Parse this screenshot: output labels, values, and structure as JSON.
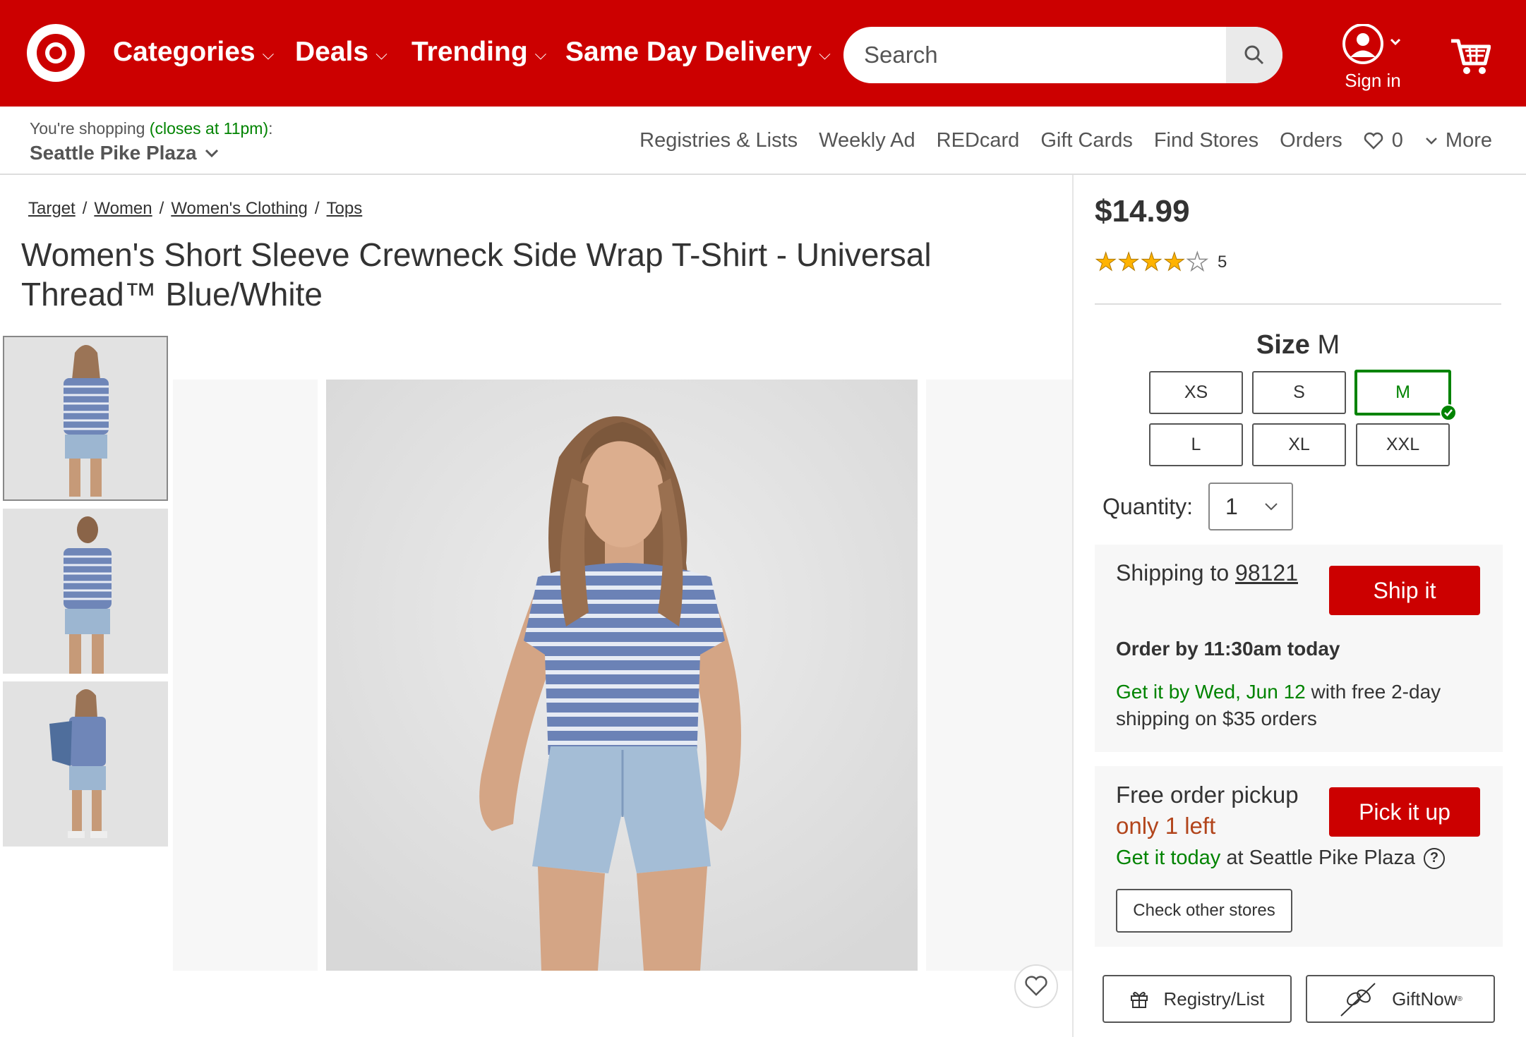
{
  "colors": {
    "brand_red": "#cc0000",
    "green": "#008300",
    "orange": "#b2451c"
  },
  "header": {
    "nav": [
      {
        "label": "Categories"
      },
      {
        "label": "Deals"
      },
      {
        "label": "Trending"
      },
      {
        "label": "Same Day Delivery"
      }
    ],
    "search_placeholder": "Search",
    "sign_in": "Sign in"
  },
  "subnav": {
    "shopping_prefix": "You're shopping ",
    "closes": "(closes at 11pm)",
    "colon": ":",
    "store": "Seattle Pike Plaza",
    "links": [
      "Registries & Lists",
      "Weekly Ad",
      "REDcard",
      "Gift Cards",
      "Find Stores",
      "Orders"
    ],
    "favorites_count": "0",
    "more": "More"
  },
  "breadcrumb": [
    "Target",
    "Women",
    "Women's Clothing",
    "Tops"
  ],
  "product": {
    "title_line1": "Women's Short Sleeve Crewneck Side Wrap T-Shirt - Universal",
    "title_line2": "Thread™ Blue/White",
    "price": "$14.99",
    "rating": 4,
    "rating_max": 5,
    "review_count": "5",
    "size_label": "Size",
    "size_selected": "M",
    "sizes": [
      "XS",
      "S",
      "M",
      "L",
      "XL",
      "XXL"
    ],
    "quantity_label": "Quantity:",
    "quantity": "1"
  },
  "shipping": {
    "prefix": "Shipping to ",
    "zip": "98121",
    "button": "Ship it",
    "order_by": "Order by 11:30am today",
    "get_it_by": "Get it by Wed, Jun 12",
    "get_it_rest": " with free 2-day shipping on $35 orders"
  },
  "pickup": {
    "title": "Free order pickup",
    "only_left": "only 1 left",
    "button": "Pick it up",
    "get_today": "Get it today",
    "at_store": " at Seattle Pike Plaza",
    "help": "?",
    "check_stores": "Check other stores"
  },
  "actions": {
    "registry": "Registry/List",
    "giftnow": "GiftNow",
    "giftnow_mark": "®"
  }
}
